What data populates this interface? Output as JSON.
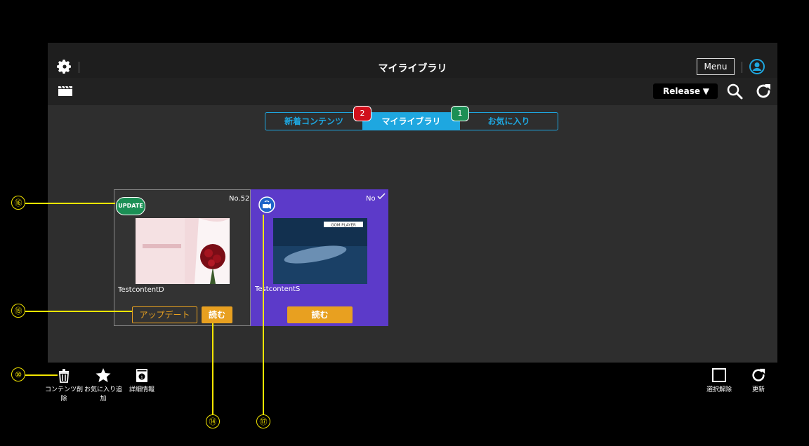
{
  "header": {
    "title": "マイライブラリ",
    "menu_label": "Menu"
  },
  "subbar": {
    "release_label": "Release",
    "release_arrow": "▼"
  },
  "tabs": [
    {
      "label": "新着コンテンツ",
      "badge": "2",
      "badge_color": "#d0101c"
    },
    {
      "label": "マイライブラリ",
      "active": true
    },
    {
      "label": "お気に入り",
      "badge": "1",
      "badge_color": "#1b8f55"
    }
  ],
  "cards": [
    {
      "badge": "UPDATE",
      "number": "No.52",
      "name": "TestcontentD",
      "update_label": "アップデート",
      "read_label": "読む"
    },
    {
      "number": "No",
      "name": "TestcontentS",
      "read_label": "読む",
      "thumb_brand": "GOM PLAYER"
    }
  ],
  "toolbar": {
    "delete_label_1": "コンテンツ削",
    "delete_label_2": "除",
    "fav_label_1": "お気に入り追",
    "fav_label_2": "加",
    "info_label": "詳細情報",
    "deselect_label": "選択解除",
    "refresh_label": "更新"
  },
  "callouts": {
    "c16": "⑯",
    "c19": "⑲",
    "c10": "⑩",
    "c14": "⑭",
    "c17": "⑰"
  },
  "colors": {
    "accent": "#1ea7e0",
    "orange": "#e8a020",
    "purple": "#5c3ac9",
    "callout": "#f4e600"
  }
}
